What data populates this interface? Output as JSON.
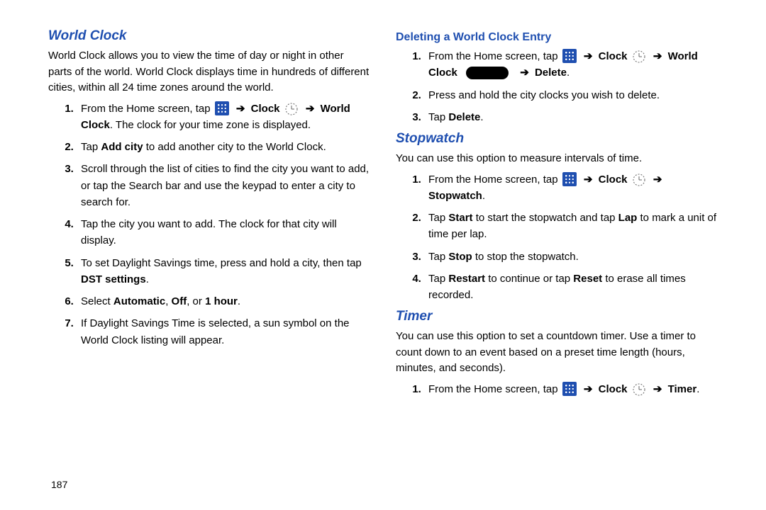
{
  "page_number": "187",
  "left": {
    "world_clock_heading": "World Clock",
    "world_clock_intro": "World Clock allows you to view the time of day or night in other parts of the world. World Clock displays time in hundreds of different cities, within all 24 time zones around the world.",
    "wc_step1_prefix": "From the Home screen, tap",
    "wc_step1_clock": "Clock",
    "wc_step1_boldpath": "World Clock",
    "wc_step1_suffix": ". The clock for your time zone is displayed.",
    "wc_step2_pre": "Tap ",
    "wc_step2_bold": "Add city",
    "wc_step2_post": " to add another city to the World Clock.",
    "wc_step3": "Scroll through the list of cities to find the city you want to add, or tap the Search bar and use the keypad to enter a city to search for.",
    "wc_step4": "Tap the city you want to add. The clock for that city will display.",
    "wc_step5_pre": "To set Daylight Savings time, press and hold a city, then tap ",
    "wc_step5_bold": "DST settings",
    "wc_step5_post": ".",
    "wc_step6_pre": "Select ",
    "wc_step6_b1": "Automatic",
    "wc_step6_sep1": ", ",
    "wc_step6_b2": "Off",
    "wc_step6_sep2": ", or ",
    "wc_step6_b3": "1 hour",
    "wc_step6_post": ".",
    "wc_step7": "If Daylight Savings Time is selected, a sun symbol on the World Clock listing will appear."
  },
  "right": {
    "delete_heading": "Deleting a World Clock Entry",
    "del_step1_prefix": "From the Home screen, tap",
    "del_step1_clock": "Clock",
    "del_step1_worldclock": "World Clock",
    "del_step1_delete": "Delete",
    "del_step1_period": ".",
    "del_step2": "Press and hold the city clocks you wish to delete.",
    "del_step3_pre": "Tap ",
    "del_step3_bold": "Delete",
    "del_step3_post": ".",
    "stopwatch_heading": "Stopwatch",
    "stopwatch_intro": "You can use this option to measure intervals of time.",
    "sw_step1_prefix": "From the Home screen, tap",
    "sw_step1_clock": "Clock",
    "sw_step1_bold": "Stopwatch",
    "sw_step1_post": ".",
    "sw_step2_pre": "Tap ",
    "sw_step2_b1": "Start",
    "sw_step2_mid": " to start the stopwatch and tap ",
    "sw_step2_b2": "Lap",
    "sw_step2_post": " to mark a unit of time per lap.",
    "sw_step3_pre": "Tap ",
    "sw_step3_bold": "Stop",
    "sw_step3_post": " to stop the stopwatch.",
    "sw_step4_pre": "Tap ",
    "sw_step4_b1": "Restart",
    "sw_step4_mid": " to continue or tap ",
    "sw_step4_b2": "Reset",
    "sw_step4_post": " to erase all times recorded.",
    "timer_heading": "Timer",
    "timer_intro": "You can use this option to set a countdown timer. Use a timer to count down to an event based on a preset time length (hours, minutes, and seconds).",
    "tm_step1_prefix": "From the Home screen, tap",
    "tm_step1_clock": "Clock",
    "tm_step1_bold": "Timer",
    "tm_step1_post": "."
  }
}
